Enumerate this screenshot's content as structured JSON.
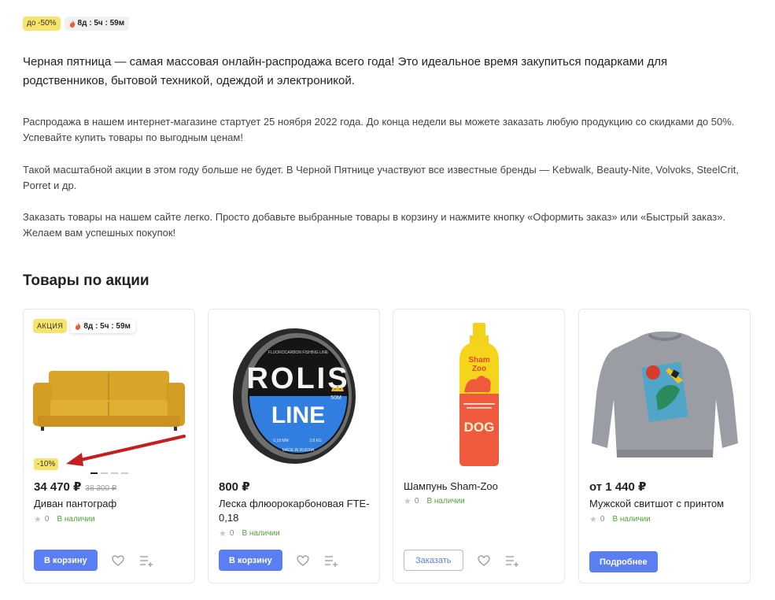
{
  "top": {
    "sale_badge": "до -50%",
    "timer": "8д : 5ч : 59м"
  },
  "intro": "Черная пятница — самая массовая онлайн-распродажа всего года! Это идеальное время закупиться подарками для родственников, бытовой техникой, одеждой и электроникой.",
  "paragraphs": [
    "Распродажа в нашем интернет-магазине стартует 25 ноября 2022 года. До конца недели вы можете заказать любую продукцию со скидками до 50%. Успевайте купить товары по выгодным ценам!",
    "Такой масштабной акции в этом году больше не будет. В Черной Пятнице участвуют все известные бренды — Kebwalk, Beauty-Nite, Volvoks, SteelCrit, Porret и др.",
    "Заказать товары на нашем сайте легко. Просто добавьте выбранные товары в корзину и нажмите кнопку «Оформить заказ» или «Быстрый заказ». Желаем вам успешных покупок!"
  ],
  "section_title": "Товары по акции",
  "products": [
    {
      "badge": "АКЦИЯ",
      "timer": "8д : 5ч : 59м",
      "discount": "-10%",
      "price": "34 470 ₽",
      "old_price": "38 300 ₽",
      "name": "Диван пантограф",
      "rating": "0",
      "stock": "В наличии",
      "button": "В корзину"
    },
    {
      "price": "800 ₽",
      "name": "Леска флюорокарбоновая FTE-0,18",
      "rating": "0",
      "stock": "В наличии",
      "button": "В корзину",
      "spool": {
        "brand_top": "ROLIS",
        "brand_bottom": "LINE",
        "length": "50M",
        "small_text": "FLUOROCARBON FISHING LINE",
        "diameter": "0,18 MM",
        "strength": "2,8 KG",
        "origin": "MADE IN RUSSIA"
      }
    },
    {
      "name": "Шампунь Sham-Zoo",
      "rating": "0",
      "stock": "В наличии",
      "button": "Заказать",
      "bottle": {
        "brand_line1": "Sham",
        "brand_line2": "Zoo",
        "label": "DOG"
      }
    },
    {
      "price": "от 1 440 ₽",
      "name": "Мужской свитшот с принтом",
      "rating": "0",
      "stock": "В наличии",
      "button": "Подробнее"
    }
  ],
  "colors": {
    "accent": "#5b7ef2",
    "badge": "#f7e46a",
    "stock": "#52a335",
    "arrow": "#c41e1e"
  },
  "icons": [
    "flame-icon",
    "star-icon",
    "heart-icon",
    "compare-icon"
  ]
}
